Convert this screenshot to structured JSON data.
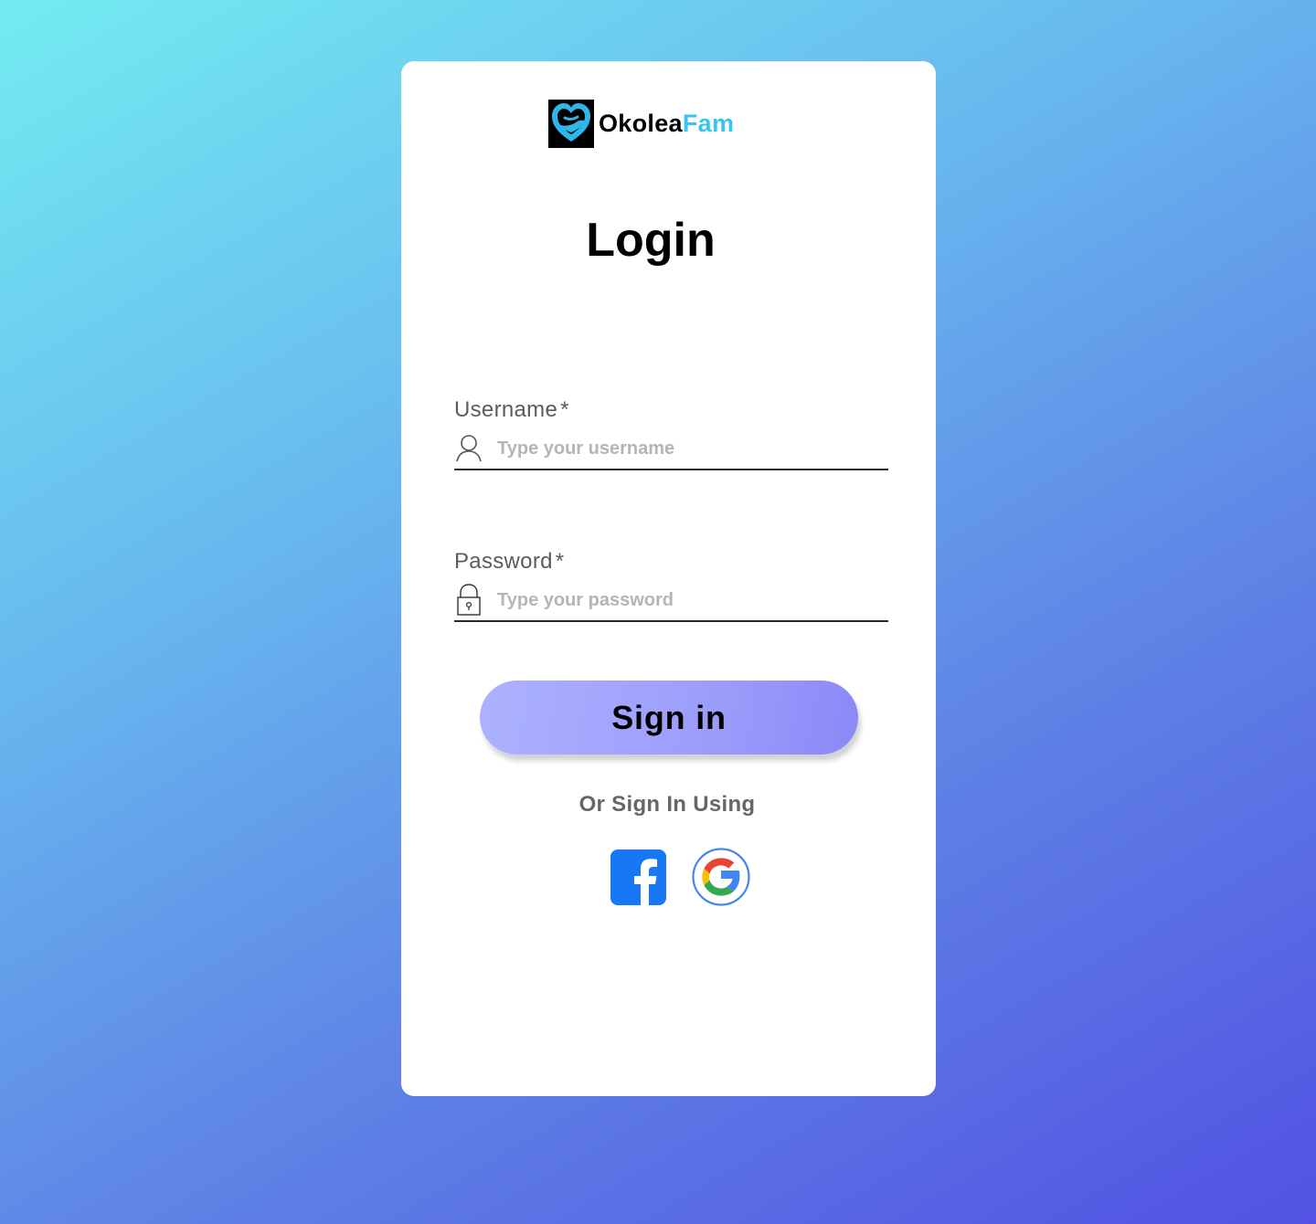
{
  "brand": {
    "name_part1": "Okolea",
    "name_part2": "Fam",
    "logo_icon": "heart-hands-logo-icon",
    "accent_color": "#39c3ef"
  },
  "login": {
    "title": "Login"
  },
  "username": {
    "label": "Username",
    "required_mark": "*",
    "placeholder": "Type your username",
    "value": "",
    "icon": "user-icon"
  },
  "password": {
    "label": "Password",
    "required_mark": "*",
    "placeholder": "Type your password",
    "value": "",
    "icon": "lock-icon"
  },
  "signin": {
    "label": "Sign in"
  },
  "alternative": {
    "text": "Or Sign In Using",
    "providers": [
      {
        "name": "facebook",
        "icon": "facebook-icon",
        "color": "#1877f2"
      },
      {
        "name": "google",
        "icon": "google-icon",
        "color": "#4285f4"
      }
    ]
  },
  "colors": {
    "background_start": "#72ecf0",
    "background_end": "#5251e3",
    "button_start": "#acb2ff",
    "button_end": "#8a88f7"
  }
}
